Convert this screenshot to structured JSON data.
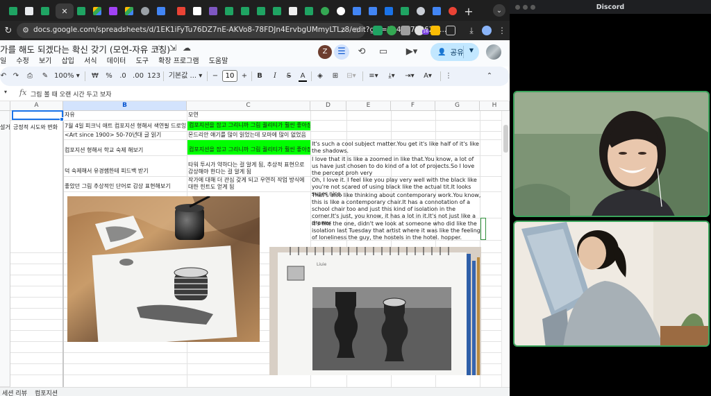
{
  "browser": {
    "tab_labels": [
      "",
      "",
      "",
      "",
      "",
      "",
      "",
      "",
      "",
      "",
      "",
      "",
      "",
      "",
      "",
      "",
      "",
      "",
      "",
      "",
      "",
      "",
      "",
      "",
      "",
      "",
      "",
      "",
      "",
      ""
    ],
    "close_glyph": "✕",
    "newtab_glyph": "+",
    "url": "docs.google.com/spreadsheets/d/1EK1iFyTu76DZ7nE-AKVo8-78FDJn4ErvbgUMmyLTLz8/edit?gid=1146773062#..."
  },
  "sheets": {
    "title": "가를 해도 되겠다는 확신 갖기 (모연-자유 코칭)",
    "menu": [
      "일",
      "수정",
      "보기",
      "삽입",
      "서식",
      "데이터",
      "도구",
      "확장 프로그램",
      "도움말"
    ],
    "avatar_letter": "Z",
    "share_label": "공유",
    "toolbar": {
      "zoom": "100%",
      "currency": "₩",
      "percent": "%",
      "dec_dec": ".0",
      "dec_inc": ".00",
      "number_format": "123",
      "font": "기본값 ...",
      "font_size": "10",
      "bold": "B",
      "italic": "I",
      "strike": "S",
      "text_color": "A",
      "text_color_underline": "#000000"
    },
    "formula": "그림 볼 때 오랜 시간 두고 보자",
    "fx": "fx",
    "columns": [
      "A",
      "B",
      "C",
      "D",
      "E",
      "F",
      "G",
      "H"
    ],
    "header_row": {
      "b": "자유",
      "c": "모연"
    },
    "rows": [
      {
        "a": "긍정적 시도와 변화",
        "a_left": "설거",
        "b": "7월 4일 피크닉 애트 컴포지션 형해서 색연필 드로잉하기",
        "c": "컴포지션을 잡고 그리니까 그림 퀄리티가 훨씬 좋아짐",
        "c_green": true,
        "d": ""
      },
      {
        "b": "<Art since 1900> 50-70년대 글 읽기",
        "c": "몬드리안 얘기를 많이 읽었는데 모마에 많이 없었음",
        "d": ""
      },
      {
        "b": "컴포지션 형해서 학교 숙제 해보기",
        "c": "컴포지션을 잡고 그리니까 그림 퀄리티가 훨씬 좋아짐",
        "c_green": true,
        "d": "It's such a cool subject matter.You get it's like half of it's like the shadows."
      },
      {
        "b": "덕 숙제해서 유경쌤한테 피드백 받기",
        "c": "타워 투시가 약하다는 걸 알게 됨, 추상적 표현으로 감상해야 한다는 걸 알게 됨",
        "d": "I love that it is like a zoomed in like that.You know, a lot of us have just chosen to do kind of a lot of projects.So I love the percept proh very"
      },
      {
        "b": "좋았던 그림 추상적인 단어로 감상 표현해보기",
        "c": "작가에 대해 더 관심 갖게 되고 우연히 작업 방식에 대한 힌트도 얻게 됨",
        "d": "Oh, I love it. I feel like you play very well with the black like you're not scared of using black like the actual tit.It looks super nice."
      },
      {
        "d": "That's also like thinking about contemporary work.You know, this is like a contemporary chair.It has a connotation of a school chair too and just this kind of isolation in the corner.It's just, you know, it has a lot in it.It's not just like a drawer"
      },
      {
        "d": "it's like the one, didn't we look at someone who did like the isolation last Tuesday that artist where it was like the feeling of loneliness the guy, the hostels in the hotel. hopper."
      }
    ],
    "sheet_tabs": [
      "세션 리뷰",
      "컴포지션"
    ],
    "photo2_caption": "Liuie"
  },
  "discord": {
    "title": "Discord"
  },
  "colors": {
    "green_highlight": "#00ff00",
    "speaking_border": "#3ba55c",
    "share_bg": "#c2e7ff",
    "selection": "#1a73e8"
  },
  "icons": [
    "reload-icon",
    "site-settings-icon",
    "zoom-icon",
    "star-icon",
    "extensions-icon",
    "download-icon",
    "move-icon",
    "cloud-icon",
    "history-icon",
    "comment-icon",
    "meet-icon",
    "undo-icon",
    "redo-icon",
    "print-icon",
    "paint-format-icon",
    "fill-color-icon",
    "borders-icon",
    "merge-icon",
    "align-icon",
    "more-icon",
    "collapse-icon",
    "fx-icon"
  ]
}
